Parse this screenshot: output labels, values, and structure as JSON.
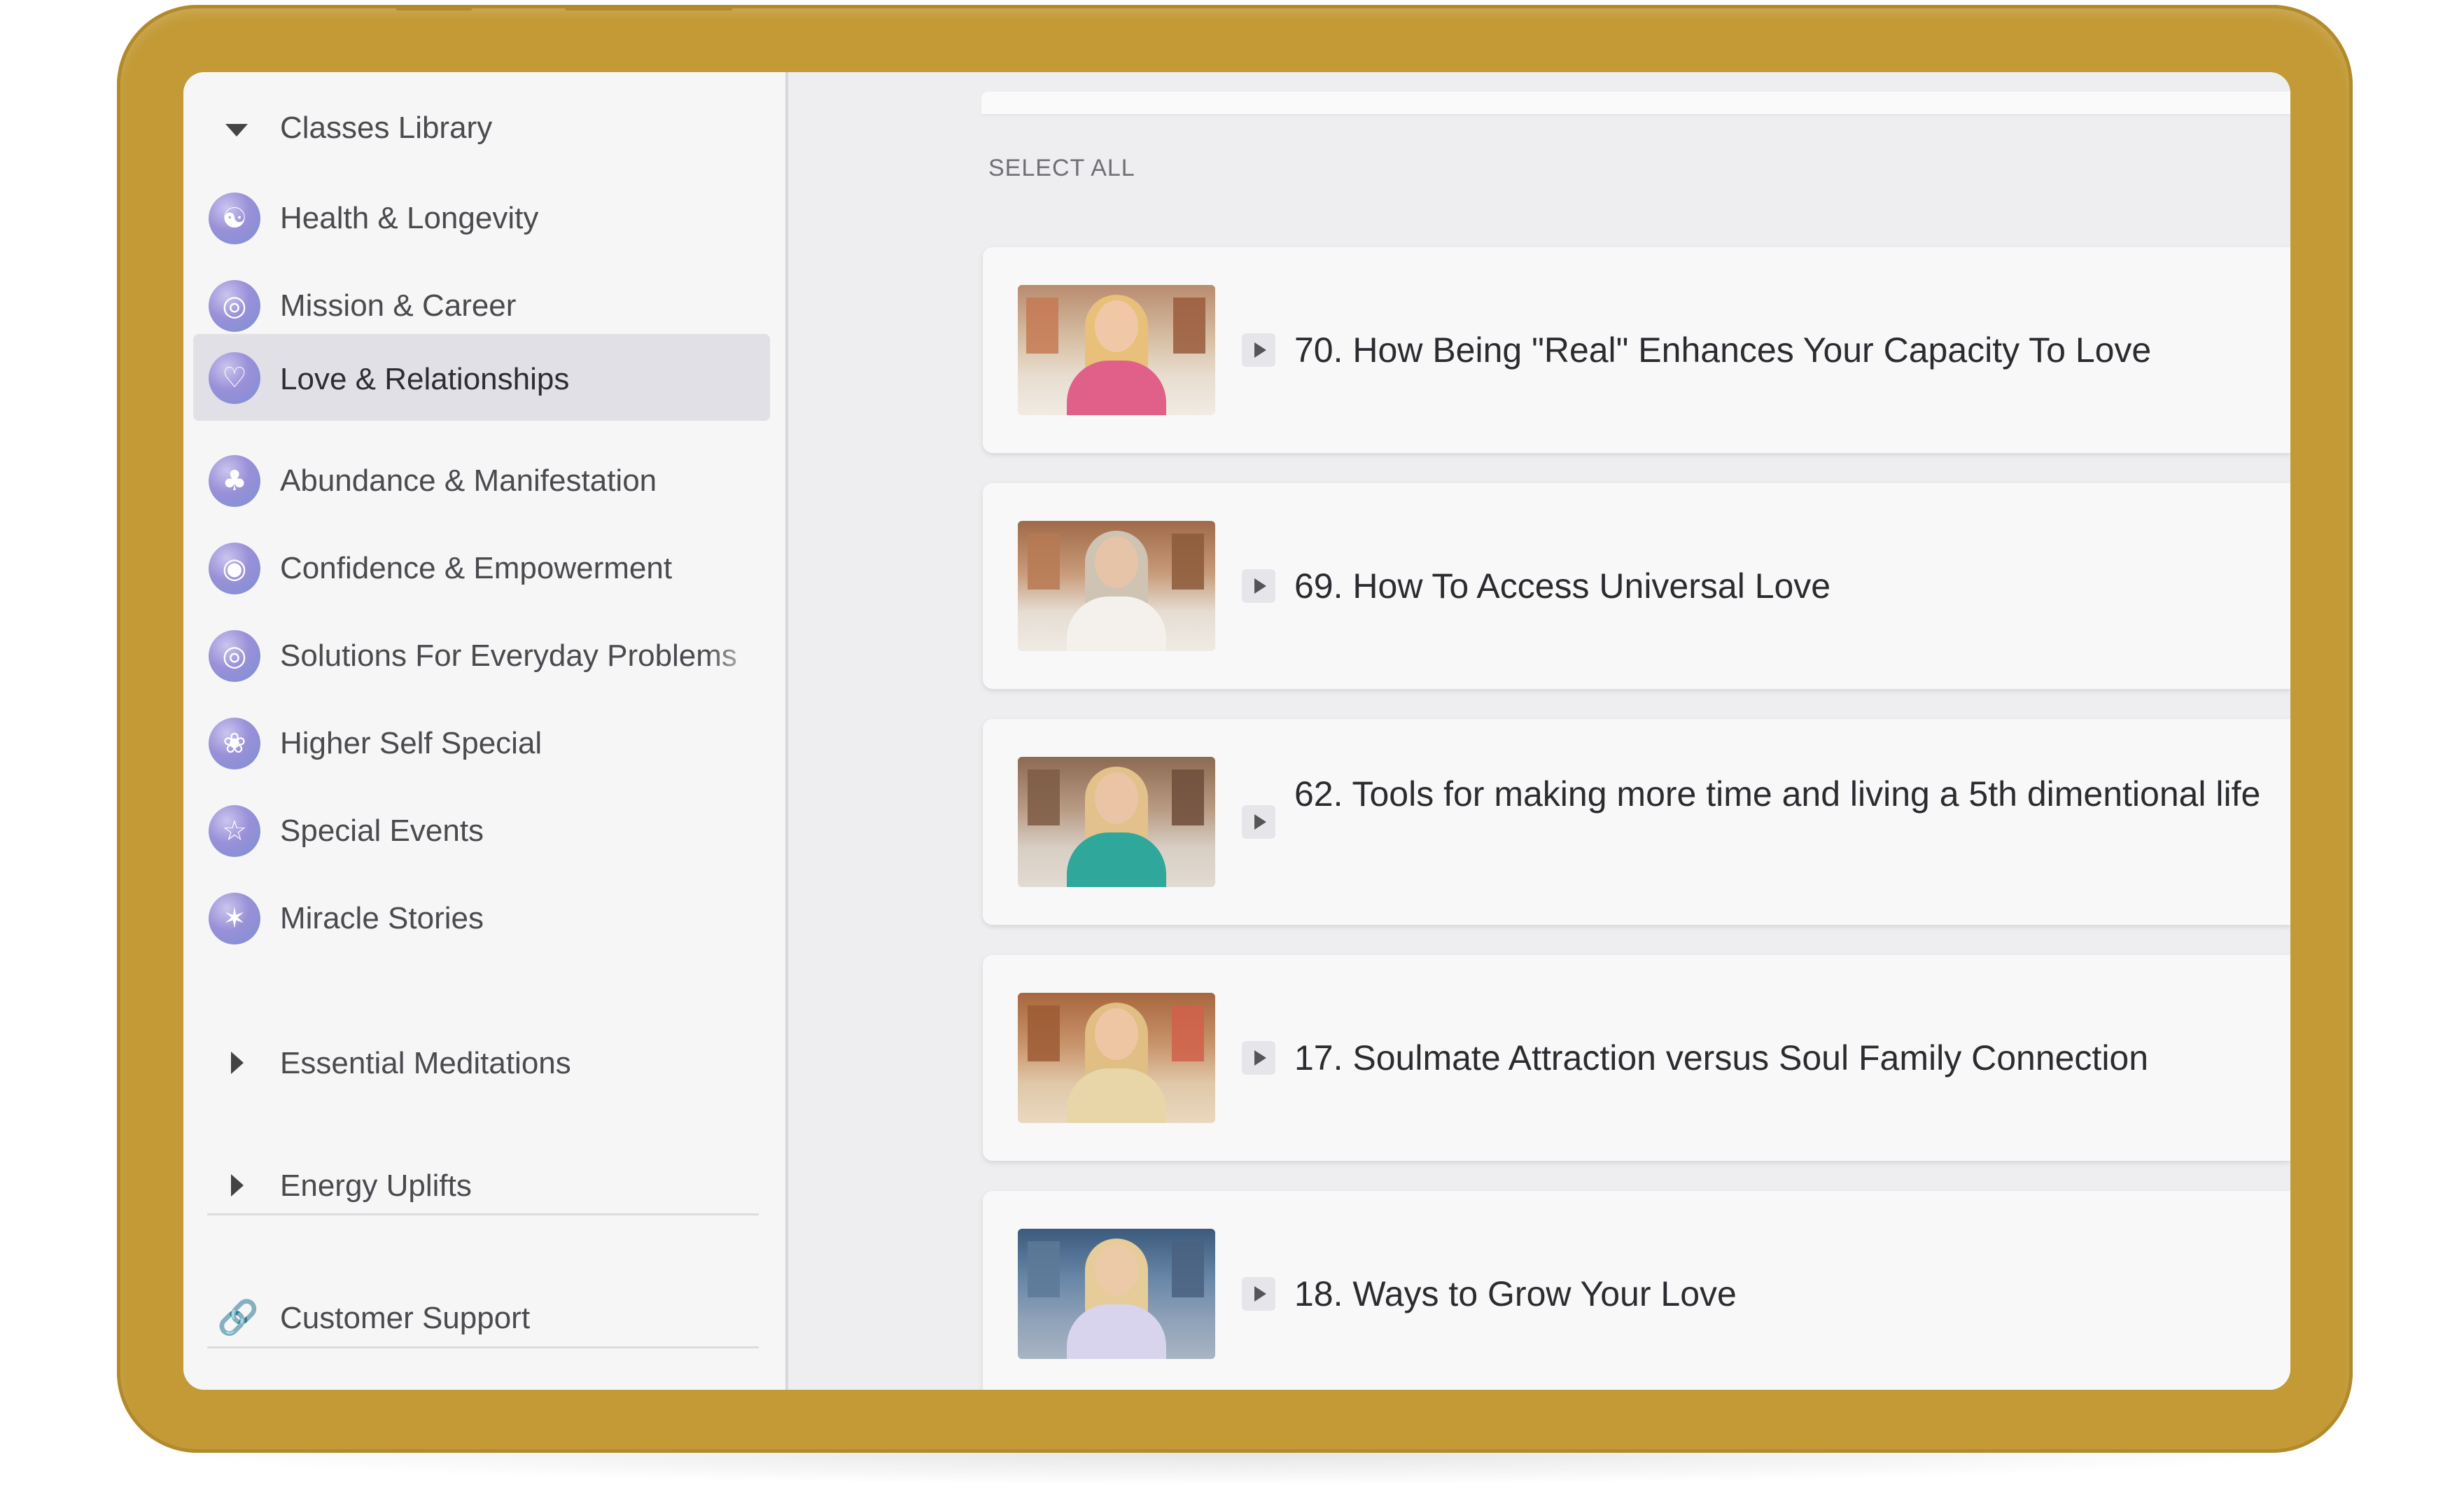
{
  "sidebar": {
    "library_header": {
      "label": "Classes Library",
      "icon": "caret-down-icon"
    },
    "categories": [
      {
        "label": "Health & Longevity",
        "icon": "meditation-icon",
        "glyph": "☯",
        "active": false
      },
      {
        "label": "Mission & Career",
        "icon": "target-icon",
        "glyph": "◎",
        "active": false
      },
      {
        "label": "Love & Relationships",
        "icon": "heart-icon",
        "glyph": "♡",
        "active": true
      },
      {
        "label": "Abundance & Manifestation",
        "icon": "palm-tree-icon",
        "glyph": "♣",
        "active": false
      },
      {
        "label": "Confidence & Empowerment",
        "icon": "eye-icon",
        "glyph": "◉",
        "active": false
      },
      {
        "label": "Solutions For Everyday Problems",
        "icon": "spiral-icon",
        "glyph": "◎",
        "active": false
      },
      {
        "label": "Higher Self Special",
        "icon": "lotus-icon",
        "glyph": "❀",
        "active": false
      },
      {
        "label": "Special Events",
        "icon": "star-icon",
        "glyph": "☆",
        "active": false
      },
      {
        "label": "Miracle Stories",
        "icon": "sparkle-icon",
        "glyph": "✶",
        "active": false
      }
    ],
    "groups": [
      {
        "label": "Essential Meditations",
        "icon": "caret-right-icon"
      },
      {
        "label": "Energy Uplifts",
        "icon": "caret-right-icon"
      }
    ],
    "support": {
      "label": "Customer Support",
      "icon": "link-icon",
      "glyph": "🔗"
    }
  },
  "main": {
    "select_all": "SELECT ALL",
    "classes": [
      {
        "title": "70. How Being \"Real\" Enhances Your Capacity To Love",
        "thumb_icon": "video-thumbnail"
      },
      {
        "title": "69. How To Access Universal Love",
        "thumb_icon": "video-thumbnail"
      },
      {
        "title": "62. Tools for making more time and living a 5th dimentional life",
        "thumb_icon": "video-thumbnail"
      },
      {
        "title": "17. Soulmate Attraction versus Soul Family Connection",
        "thumb_icon": "video-thumbnail"
      },
      {
        "title": "18. Ways to Grow Your Love",
        "thumb_icon": "video-thumbnail"
      }
    ]
  },
  "colors": {
    "device_frame": "#c39a36",
    "sidebar_bg": "#f6f6f7",
    "active_item_bg": "#e0e0e6",
    "content_bg": "#eeeef0",
    "card_bg": "#f8f8f9",
    "icon_gradient": "#9a90d8"
  }
}
